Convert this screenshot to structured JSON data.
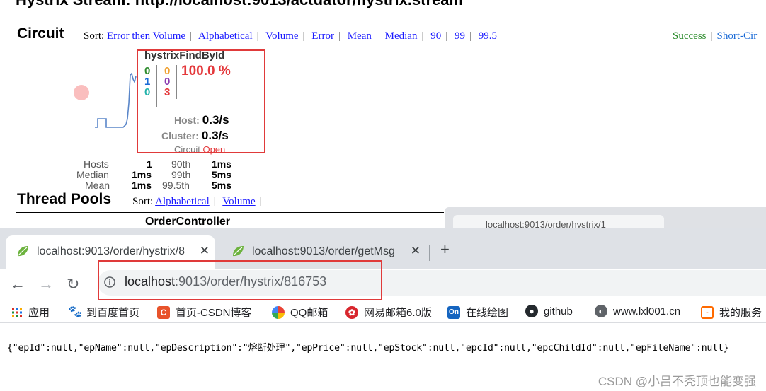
{
  "dashboard": {
    "title": "Hystrix Stream: http://localhost:9013/actuator/hystrix.stream",
    "circuit_heading": "Circuit",
    "circuit_sort_label": "Sort:",
    "circuit_sort_options": [
      "Error then Volume",
      "Alphabetical",
      "Volume",
      "Error",
      "Mean",
      "Median",
      "90",
      "99",
      "99.5"
    ],
    "legend": {
      "success": "Success",
      "short_circuited": "Short-Cir"
    },
    "command": {
      "name": "hystrixFindById",
      "counts": {
        "success": "0",
        "short_circuited": "1",
        "bad_request": "0",
        "timeout": "0",
        "rejected": "0",
        "failure": "3"
      },
      "error_rate": "100.0 %",
      "host_label": "Host:",
      "host_rate": "0.3/s",
      "cluster_label": "Cluster:",
      "cluster_rate": "0.3/s",
      "circuit_label": "Circuit",
      "circuit_state": "Open"
    },
    "stats": {
      "hosts_label": "Hosts",
      "hosts_value": "1",
      "median_label": "Median",
      "median_value": "1ms",
      "mean_label": "Mean",
      "mean_value": "1ms",
      "p90_label": "90th",
      "p90_value": "1ms",
      "p99_label": "99th",
      "p99_value": "5ms",
      "p995_label": "99.5th",
      "p995_value": "5ms"
    },
    "threadpools_heading": "Thread Pools",
    "threadpools_sort_label": "Sort:",
    "threadpools_sort_options": [
      "Alphabetical",
      "Volume"
    ],
    "threadpool_name": "OrderController",
    "ghost_tab_text": "localhost:9013/order/hystrix/1"
  },
  "browser": {
    "tabs": [
      {
        "title": "localhost:9013/order/hystrix/8",
        "active": true
      },
      {
        "title": "localhost:9013/order/getMsg",
        "active": false
      }
    ],
    "address": {
      "host": "localhost",
      "path": ":9013/order/hystrix/816753"
    },
    "bookmarks": [
      {
        "label": "应用",
        "icon": "apps-grid-icon"
      },
      {
        "label": "到百度首页",
        "icon": "baidu-paw-icon"
      },
      {
        "label": "首页-CSDN博客",
        "icon": "csdn-icon"
      },
      {
        "label": "QQ邮箱",
        "icon": "qq-mail-icon"
      },
      {
        "label": "网易邮箱6.0版",
        "icon": "netease-mail-icon"
      },
      {
        "label": "在线绘图",
        "icon": "drawio-icon"
      },
      {
        "label": "github",
        "icon": "github-icon"
      },
      {
        "label": "www.lxl001.cn",
        "icon": "globe-icon"
      },
      {
        "label": "我的服务",
        "icon": "aliyun-icon"
      }
    ],
    "page_json": "{\"epId\":null,\"epName\":null,\"epDescription\":\"熔断处理\",\"epPrice\":null,\"epStock\":null,\"epcId\":null,\"epcChildId\":null,\"epFileName\":null}",
    "watermark": "CSDN @小吕不秃顶也能变强"
  },
  "colors": {
    "annotation_red": "#e03a3a",
    "error_red": "#e4383b",
    "link_blue": "#1a1aff",
    "success_green": "#2a8a2a"
  }
}
